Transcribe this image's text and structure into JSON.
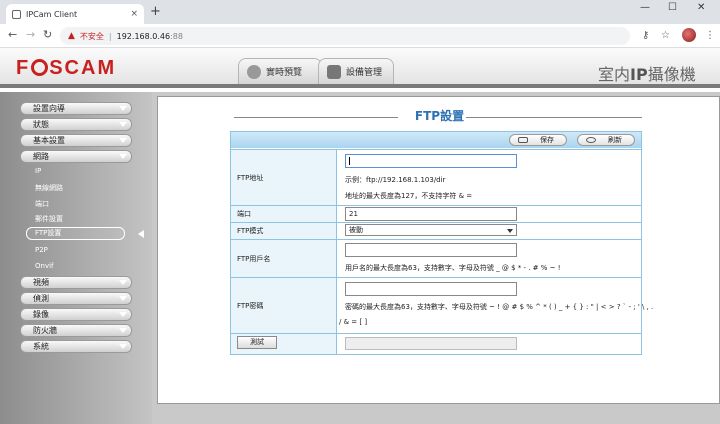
{
  "browser": {
    "tab_title": "IPCam Client",
    "tab_close": "×",
    "new_tab": "+",
    "minimize": "—",
    "maximize": "☐",
    "close": "✕",
    "security_warning": "不安全",
    "url_host": "192.168.0.46",
    "url_port": ":88"
  },
  "header": {
    "logo_prefix": "F",
    "logo_suffix": "SCAM",
    "tab_live": "實時預覽",
    "tab_settings": "設備管理",
    "brand_pre": "室内",
    "brand_bold": "IP",
    "brand_post": "攝像機"
  },
  "sidebar": {
    "setup_wizard": "設置向導",
    "status": "狀態",
    "basic_settings": "基本設置",
    "network": "網路",
    "sub": {
      "ip": "IP",
      "wireless": "無線網路",
      "port": "端口",
      "mail": "郵件設置",
      "ftp": "FTP設置",
      "p2p": "P2P",
      "onvif": "Onvif"
    },
    "video": "視頻",
    "detector": "偵測",
    "record": "錄像",
    "firewall": "防火牆",
    "system": "系統"
  },
  "panel": {
    "title": "FTP設置",
    "save": "保存",
    "refresh": "刷新",
    "rows": {
      "ftp_address_label": "FTP地址",
      "ftp_address_value": "",
      "example": "示例：ftp://192.168.1.103/dir",
      "addr_note": "地址的最大長度為127，不支持字符 & =",
      "port_label": "端口",
      "port_value": "21",
      "mode_label": "FTP模式",
      "mode_value": "被動",
      "user_label": "FTP用戶名",
      "user_value": "",
      "user_note": "用戶名的最大長度為63，支持數字、字母及符號 _ @ $ * - . # % ~ !",
      "pwd_label": "FTP密碼",
      "pwd_value": "",
      "pwd_note_1": "密碼的最大長度為63，支持數字、字母及符號 ~ ! @ # $ % ^ * ( ) _ + { } : \" | < > ? ` - ; ' \\ , .",
      "pwd_note_2": "/ & = [ ]",
      "test": "測試",
      "test_result": ""
    }
  }
}
